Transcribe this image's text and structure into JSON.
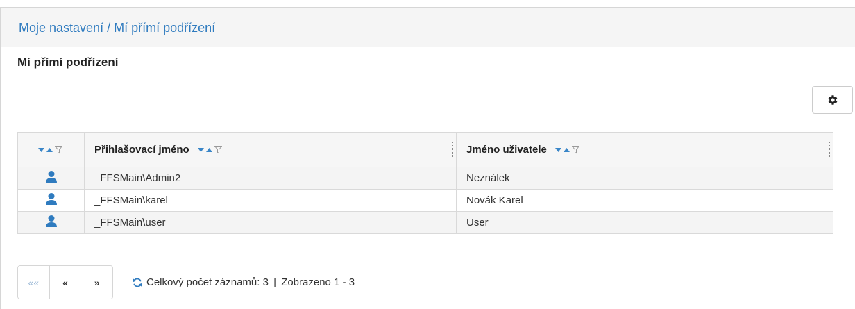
{
  "header": {
    "breadcrumb": "Moje nastavení / Mí přímí podřízení"
  },
  "section": {
    "title": "Mí přímí podřízení"
  },
  "toolbar": {
    "settings_icon": "gear-icon"
  },
  "grid": {
    "columns": [
      {
        "label": ""
      },
      {
        "label": "Přihlašovací jméno"
      },
      {
        "label": "Jméno uživatele"
      }
    ],
    "rows": [
      {
        "icon": "user-icon",
        "login": "_FFSMain\\Admin2",
        "name": "Neználek"
      },
      {
        "icon": "user-icon",
        "login": "_FFSMain\\karel",
        "name": "Novák Karel"
      },
      {
        "icon": "user-icon",
        "login": "_FFSMain\\user",
        "name": "User"
      }
    ]
  },
  "pager": {
    "first": "««",
    "prev": "«",
    "next": "»"
  },
  "status": {
    "total_label": "Celkový počet záznamů: 3",
    "separator": "|",
    "shown_label": "Zobrazeno 1 - 3"
  },
  "colors": {
    "accent": "#2f7bbf",
    "user_icon": "#2f7bbf"
  }
}
